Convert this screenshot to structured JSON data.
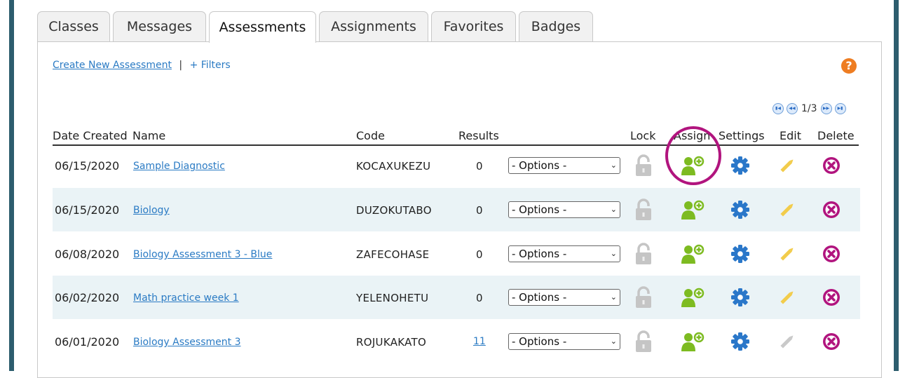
{
  "tabs": [
    {
      "label": "Classes"
    },
    {
      "label": "Messages"
    },
    {
      "label": "Assessments",
      "active": true
    },
    {
      "label": "Assignments"
    },
    {
      "label": "Favorites"
    },
    {
      "label": "Badges"
    }
  ],
  "toolbar": {
    "create_label": "Create New Assessment",
    "separator": "|",
    "filters_label": "+ Filters"
  },
  "help": {
    "icon": "question-icon",
    "glyph": "?"
  },
  "pager": {
    "info": "1/3"
  },
  "columns": {
    "date": "Date Created",
    "name": "Name",
    "code": "Code",
    "results": "Results",
    "lock": "Lock",
    "assign": "Assign",
    "settings": "Settings",
    "edit": "Edit",
    "delete": "Delete"
  },
  "rows": [
    {
      "date": "06/15/2020",
      "name": "Sample Diagnostic",
      "code": "KOCAXUKEZU",
      "results": "0",
      "results_link": false,
      "options": "- Options -",
      "edit_active": true
    },
    {
      "date": "06/15/2020",
      "name": "Biology",
      "code": "DUZOKUTABO",
      "results": "0",
      "results_link": false,
      "options": "- Options -",
      "edit_active": true
    },
    {
      "date": "06/08/2020",
      "name": "Biology Assessment 3 - Blue",
      "code": "ZAFECOHASE",
      "results": "0",
      "results_link": false,
      "options": "- Options -",
      "edit_active": true
    },
    {
      "date": "06/02/2020",
      "name": "Math practice week 1",
      "code": "YELENOHETU",
      "results": "0",
      "results_link": false,
      "options": "- Options -",
      "edit_active": true
    },
    {
      "date": "06/01/2020",
      "name": "Biology Assessment 3",
      "code": "ROJUKAKATO",
      "results": "11",
      "results_link": true,
      "options": "- Options -",
      "edit_active": false
    }
  ],
  "colors": {
    "accent_link": "#2b7bc4",
    "assign_green": "#7dbb21",
    "settings_blue": "#2a77c9",
    "edit_yellow": "#f2cc4b",
    "delete_magenta": "#b1147e",
    "highlight": "#b1147e",
    "side_bar": "#2d5d6e"
  }
}
